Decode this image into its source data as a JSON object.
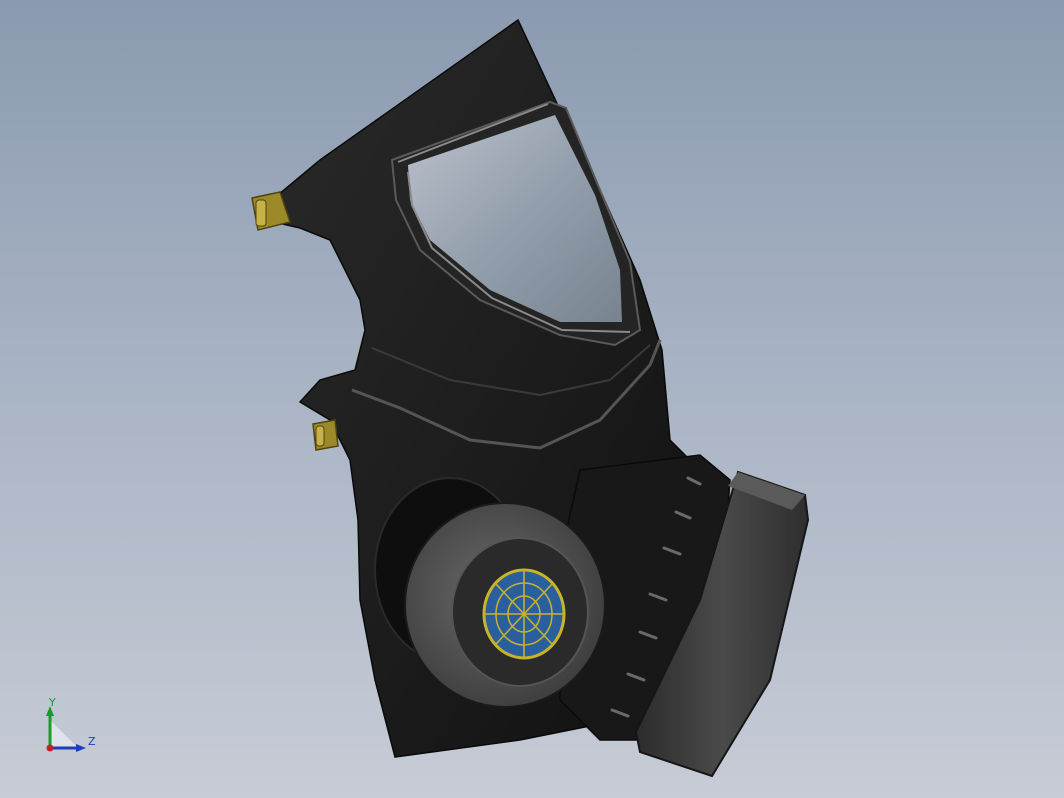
{
  "viewport": {
    "background_top": "#8b9ab0",
    "background_bottom": "#c7ccd6"
  },
  "model": {
    "mask_color": "#1e1e1e",
    "visor_color": "#9aa6b4",
    "strap_buckle_color": "#9c8a28",
    "filter_color": "#3a3a3a",
    "grille_blue": "#2a5f9e",
    "grille_gold": "#c9b32a"
  },
  "triad": {
    "y_label": "Y",
    "z_label": "Z",
    "y_color": "#1a9a2a",
    "z_color": "#1f3fb8",
    "origin_color": "#c0202a"
  }
}
